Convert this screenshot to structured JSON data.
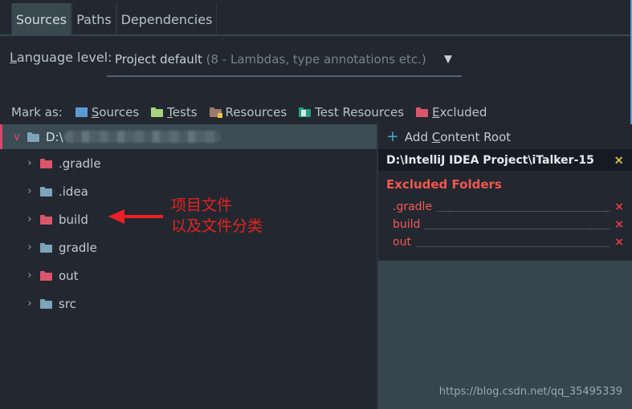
{
  "tabs": [
    {
      "label": "Sources",
      "selected": true
    },
    {
      "label": "Paths",
      "selected": false
    },
    {
      "label": "Dependencies",
      "selected": false
    }
  ],
  "language_level": {
    "label_prefix": "",
    "label_mnemonic": "L",
    "label_suffix": "anguage level:",
    "value_main": "Project default",
    "value_dim": " (8 - Lambdas, type annotations etc.)",
    "arrow": "▼"
  },
  "mark_as": {
    "label": "Mark as:",
    "items": [
      {
        "mnemonic": "S",
        "rest": "ources",
        "icon": "folder-sources-icon",
        "color": "#5b9bd5",
        "badge": "none"
      },
      {
        "mnemonic": "T",
        "rest": "ests",
        "icon": "folder-tests-icon",
        "color": "#a8d47d",
        "badge": "none"
      },
      {
        "mnemonic": "",
        "rest": "Resources",
        "icon": "folder-resources-icon",
        "color": "#9a7b6d",
        "badge": "corner"
      },
      {
        "mnemonic": "",
        "rest": "Test Resources",
        "icon": "folder-test-resources-icon",
        "color": "#1f9e86",
        "badge": "doc"
      },
      {
        "mnemonic": "E",
        "rest": "xcluded",
        "icon": "folder-excluded-icon",
        "color": "#d9566c",
        "badge": "none"
      }
    ]
  },
  "tree": {
    "root": {
      "label": "D:\\",
      "redacted": true,
      "expanded": true,
      "chevron": "∨",
      "icon": "folder-icon",
      "color": "#7fa3b8",
      "selected": true
    },
    "children": [
      {
        "label": ".gradle",
        "chevron": "›",
        "icon": "folder-excluded-icon",
        "color": "#d9566c"
      },
      {
        "label": ".idea",
        "chevron": "›",
        "icon": "folder-icon",
        "color": "#7fa3b8"
      },
      {
        "label": "build",
        "chevron": "›",
        "icon": "folder-excluded-icon",
        "color": "#d9566c"
      },
      {
        "label": "gradle",
        "chevron": "›",
        "icon": "folder-icon",
        "color": "#7fa3b8"
      },
      {
        "label": "out",
        "chevron": "›",
        "icon": "folder-excluded-icon",
        "color": "#d9566c"
      },
      {
        "label": "src",
        "chevron": "›",
        "icon": "folder-icon",
        "color": "#7fa3b8"
      }
    ]
  },
  "annotation": {
    "line1": "项目文件",
    "line2": "以及文件分类",
    "color": "#ec2024"
  },
  "right_panel": {
    "add_content_root": {
      "plus": "+",
      "prefix": "Add ",
      "mnemonic": "C",
      "suffix": "ontent Root"
    },
    "content_root": {
      "path": "D:\\IntelliJ IDEA Project\\iTalker-15",
      "close": "×"
    },
    "excluded_folders": {
      "title": "Excluded Folders",
      "items": [
        {
          "name": ".gradle",
          "close": "×"
        },
        {
          "name": "build",
          "close": "×"
        },
        {
          "name": "out",
          "close": "×"
        }
      ]
    }
  },
  "watermark": "https://blog.csdn.net/qq_35495339",
  "colors": {
    "background": "#232830",
    "panel": "#36454e",
    "selection": "#3b4c54",
    "accent_red": "#ec2024",
    "excluded": "#ef5a54",
    "link_blue": "#3fa9c4",
    "yellow": "#e2c23c"
  }
}
